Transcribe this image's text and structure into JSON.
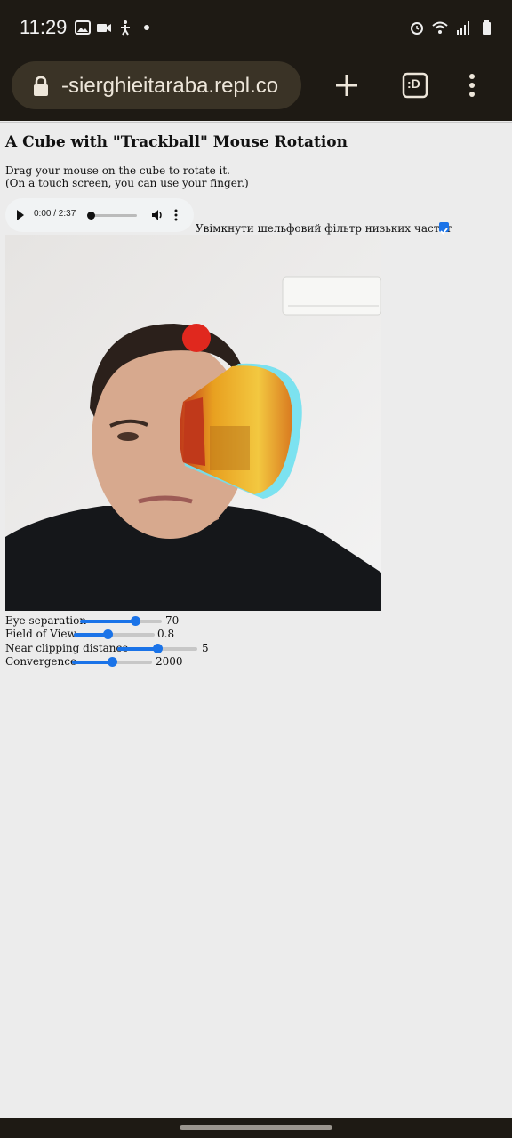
{
  "status_bar": {
    "time": "11:29",
    "left_icons": [
      "image-icon",
      "video-icon",
      "accessibility-icon",
      "dot-icon"
    ],
    "right_icons": [
      "alarm-icon",
      "wifi-icon",
      "signal-icon",
      "battery-icon"
    ]
  },
  "browser": {
    "url": "-sierghieitaraba.repl.co",
    "tab_switcher_label": ":D",
    "toolbar_icons": [
      "lock-icon",
      "plus-icon",
      "tab-switcher-icon",
      "more-vert-icon"
    ]
  },
  "page": {
    "title": "A Cube with \"Trackball\" Mouse Rotation",
    "description_line1": "Drag your mouse on the cube to rotate it.",
    "description_line2": "(On a touch screen, you can use your finger.)"
  },
  "audio_player": {
    "time": "0:00 / 2:37",
    "progress": 0.0,
    "volume_level": 0.55
  },
  "filter": {
    "label": "Увімкнути шельфовий фільтр низьких частот",
    "checked": true
  },
  "sliders": [
    {
      "label": "Eye separation",
      "value": "70",
      "fraction": 0.67
    },
    {
      "label": "Field of View",
      "value": "0.8",
      "fraction": 0.42
    },
    {
      "label": "Near clipping distance",
      "value": "5",
      "fraction": 0.5
    },
    {
      "label": "Convergence",
      "value": "2000",
      "fraction": 0.5
    }
  ],
  "colors": {
    "accent": "#1a73e8",
    "chrome": "#1e1a14",
    "urlbar": "#3a3326",
    "page_bg": "#ececec"
  }
}
